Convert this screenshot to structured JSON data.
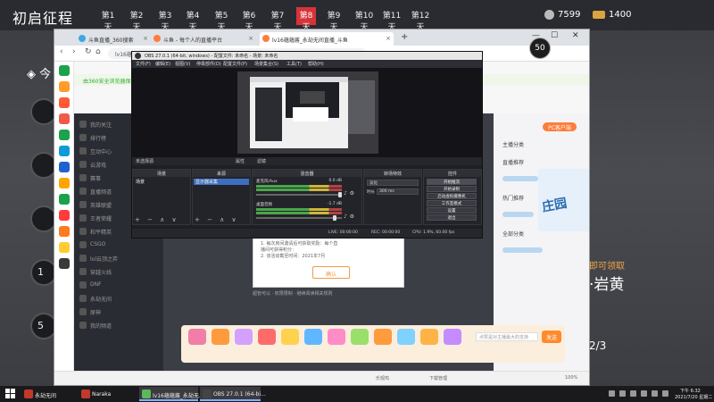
{
  "game": {
    "title": "初启征程",
    "days": [
      "第1天",
      "第2天",
      "第3天",
      "第4天",
      "第5天",
      "第6天",
      "第7天",
      "第8天",
      "第9天",
      "第10天",
      "第11天",
      "第12天"
    ],
    "active_day_index": 7,
    "coins": "7599",
    "gold": "1400",
    "left_heading": "◈ 今",
    "circle_numbers": [
      "1",
      "5"
    ],
    "right_subtitle": "即可领取",
    "right_title": "·岩黄",
    "right_page": "2/3"
  },
  "browser": {
    "tabs": [
      {
        "label": "斗鱼直播_360搜索",
        "favicon_color": "#3aa9e8"
      },
      {
        "label": "斗鱼 - 每个人的直播平台",
        "favicon_color": "#ff7d3a"
      },
      {
        "label": "lv16蕴蕴酱_永劫无间直播_斗鱼",
        "favicon_color": "#ff7d3a"
      }
    ],
    "new_tab": "+",
    "window_controls": {
      "minimize": "—",
      "maximize": "☐",
      "close": "✕"
    },
    "address": "lv16蕴蕴",
    "secure_notice": "由360安全浏览器保护",
    "status_items": [
      "乐观鸡",
      "下载管理",
      "100%"
    ],
    "timer_badge": "50"
  },
  "page": {
    "left_nav": [
      "我的关注",
      "排行榜",
      "互动中心",
      "云游戏",
      "赛事",
      "直播频道",
      "英雄联盟",
      "王者荣耀",
      "和平精英",
      "CSGO",
      "lol云顶之弈",
      "穿越火线",
      "DNF",
      "永劫无间",
      "原神",
      "我的频道"
    ],
    "pc_badge": "PC客户端",
    "right_rows": [
      "主播分类",
      "直播推荐",
      "热门推荐",
      "全部分类"
    ],
    "promo_text": "庄园",
    "dialog": {
      "line1": "1. 每次房间邀请后可获取奖励：每个直",
      "line2": "播间可获得积分：",
      "line3": "2. 该活动截至时间：2021年7月",
      "button": "确认"
    },
    "below_dialog": "超管可以 · 权限限制 · 继续阅读相关规则",
    "gift_input_placeholder": "点赞是对主播最大的支持",
    "gift_send": "发送",
    "gift_colors": [
      "#f07ea7",
      "#ff9a3d",
      "#d4a0ff",
      "#ff6b6b",
      "#ffd24d",
      "#5fb8ff",
      "#ff8cc6",
      "#9adf6b",
      "#ff9a3d",
      "#7fd1ff",
      "#ffb347",
      "#c58cff"
    ]
  },
  "obs": {
    "title": "OBS 27.0.1 (64-bit, windows) - 配置文件: 未命名 - 场景: 未命名",
    "menus": [
      "文件(F)",
      "编辑(E)",
      "视图(V)",
      "停靠部件(D)",
      "配置文件(P)",
      "场景集合(S)",
      "工具(T)",
      "帮助(H)"
    ],
    "scene_toolbar": [
      "未选择源",
      "属性",
      "滤镜"
    ],
    "docks": {
      "scenes": {
        "header": "场景",
        "items": [
          "场景"
        ]
      },
      "sources": {
        "header": "来源",
        "items": [
          "显示器采集"
        ]
      },
      "mixer": {
        "header": "混音器"
      },
      "transitions": {
        "header": "转场特效",
        "type": "淡化",
        "duration_label": "时长",
        "duration": "300 ms"
      },
      "controls": {
        "header": "控件",
        "buttons": [
          "开始推流",
          "开始录制",
          "启动虚拟摄像机",
          "工作室模式",
          "设置",
          "退出"
        ]
      }
    },
    "mixer_channels": [
      {
        "name": "麦克风/Aux",
        "db": "0.0 dB",
        "level": 0.6,
        "fader": 1.0
      },
      {
        "name": "桌面音频",
        "db": "-1.7 dB",
        "level": 0.55,
        "fader": 0.93
      }
    ],
    "status": [
      "LIVE: 00:00:00",
      "REC: 00:00:00",
      "CPU: 1.9%, 60.00 fps"
    ],
    "footer": "+ − ∧ ∨"
  },
  "taskbar": {
    "apps": [
      {
        "label": "永劫无间",
        "color": "#c0392b",
        "active": false
      },
      {
        "label": "Naraka",
        "color": "#c0392b",
        "active": false
      },
      {
        "label": "lv16蕴蕴酱_永劫无...",
        "color": "#5cb85c",
        "active": true
      },
      {
        "label": "OBS 27.0.1 (64-bi...",
        "color": "#444444",
        "active": true
      }
    ],
    "time": "下午 6:32",
    "date": "2021/7/20 星期二"
  }
}
